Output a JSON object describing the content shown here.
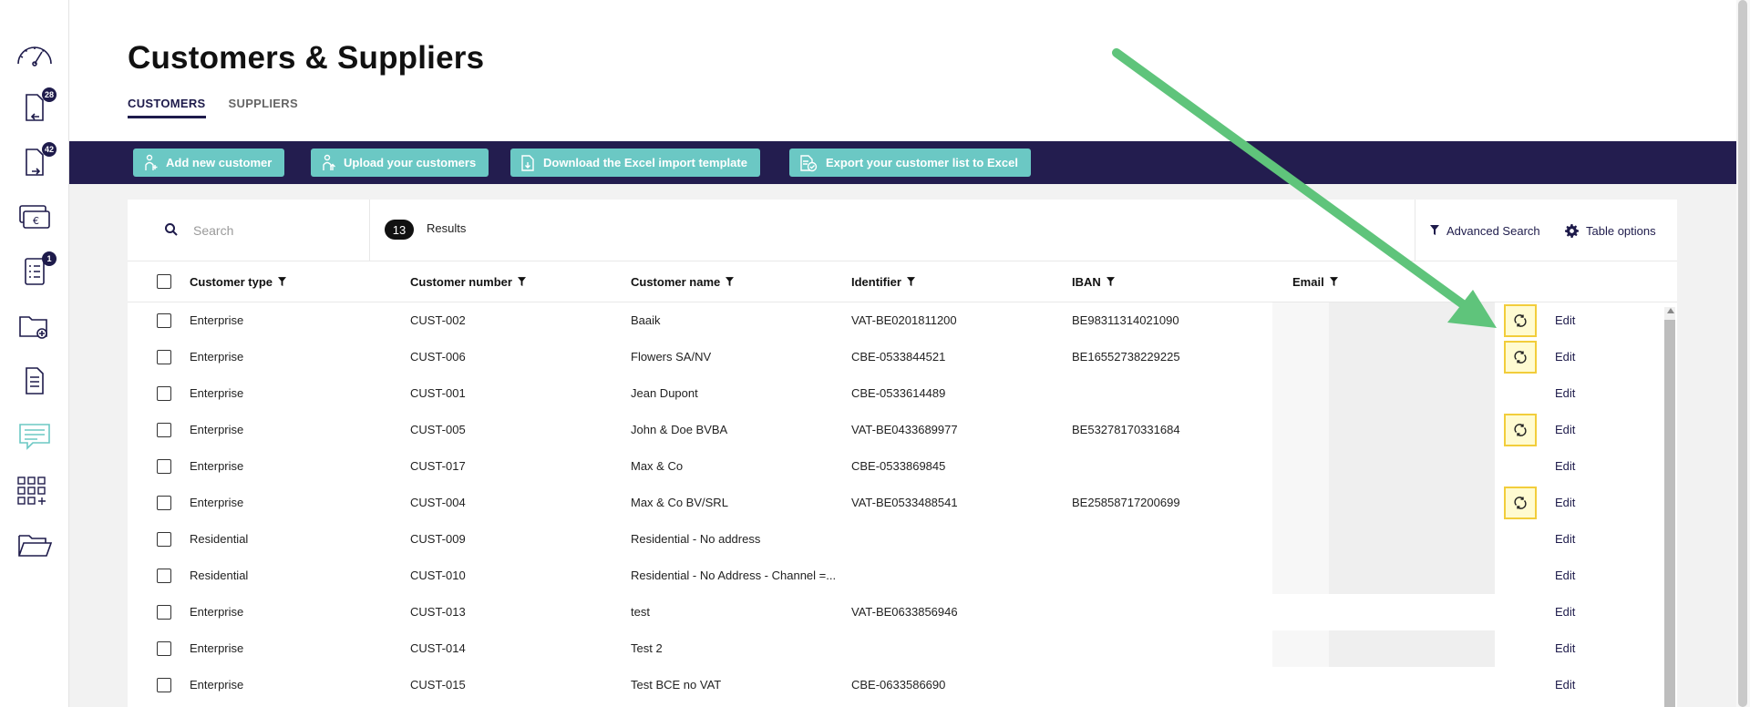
{
  "sidebar": {
    "items": [
      {
        "icon": "dashboard-gauge-icon",
        "badge": ""
      },
      {
        "icon": "incoming-documents-icon",
        "badge": "28"
      },
      {
        "icon": "outgoing-documents-icon",
        "badge": "42"
      },
      {
        "icon": "payments-euro-icon",
        "badge": ""
      },
      {
        "icon": "checklist-icon",
        "badge": "1"
      },
      {
        "icon": "add-folder-icon",
        "badge": ""
      },
      {
        "icon": "document-icon",
        "badge": ""
      },
      {
        "icon": "messages-icon",
        "badge": ""
      },
      {
        "icon": "apps-grid-icon",
        "badge": ""
      },
      {
        "icon": "open-folder-icon",
        "badge": ""
      }
    ]
  },
  "header": {
    "title": "Customers & Suppliers",
    "tabs": [
      {
        "label": "CUSTOMERS",
        "active": true
      },
      {
        "label": "SUPPLIERS",
        "active": false
      }
    ]
  },
  "toolbar": {
    "add_label": "Add new customer",
    "upload_label": "Upload your customers",
    "download_label": "Download the Excel import template",
    "export_label": "Export your customer list to Excel"
  },
  "search": {
    "placeholder": "Search",
    "value": "",
    "results_count": "13",
    "results_label": "Results",
    "advanced_label": "Advanced Search",
    "table_options_label": "Table options"
  },
  "table": {
    "columns": [
      "Customer type",
      "Customer number",
      "Customer name",
      "Identifier",
      "IBAN",
      "Email"
    ],
    "edit_label": "Edit",
    "rows": [
      {
        "type": "Enterprise",
        "number": "CUST-002",
        "name": "Baaik",
        "identifier": "VAT-BE0201811200",
        "iban": "BE98311314021090",
        "email_hidden": true,
        "sync": true
      },
      {
        "type": "Enterprise",
        "number": "CUST-006",
        "name": "Flowers SA/NV",
        "identifier": "CBE-0533844521",
        "iban": "BE16552738229225",
        "email_hidden": true,
        "sync": true
      },
      {
        "type": "Enterprise",
        "number": "CUST-001",
        "name": "Jean Dupont",
        "identifier": "CBE-0533614489",
        "iban": "",
        "email_hidden": true,
        "sync": false
      },
      {
        "type": "Enterprise",
        "number": "CUST-005",
        "name": "John & Doe BVBA",
        "identifier": "VAT-BE0433689977",
        "iban": "BE53278170331684",
        "email_hidden": true,
        "sync": true
      },
      {
        "type": "Enterprise",
        "number": "CUST-017",
        "name": "Max & Co",
        "identifier": "CBE-0533869845",
        "iban": "",
        "email_hidden": true,
        "sync": false
      },
      {
        "type": "Enterprise",
        "number": "CUST-004",
        "name": "Max & Co BV/SRL",
        "identifier": "VAT-BE0533488541",
        "iban": "BE25858717200699",
        "email_hidden": true,
        "sync": true
      },
      {
        "type": "Residential",
        "number": "CUST-009",
        "name": "Residential - No address",
        "identifier": "",
        "iban": "",
        "email_hidden": true,
        "sync": false
      },
      {
        "type": "Residential",
        "number": "CUST-010",
        "name": "Residential - No Address - Channel =...",
        "identifier": "",
        "iban": "",
        "email_hidden": true,
        "sync": false
      },
      {
        "type": "Enterprise",
        "number": "CUST-013",
        "name": "test",
        "identifier": "VAT-BE0633856946",
        "iban": "",
        "email_hidden": false,
        "sync": false
      },
      {
        "type": "Enterprise",
        "number": "CUST-014",
        "name": "Test 2",
        "identifier": "",
        "iban": "",
        "email_hidden": true,
        "sync": false
      },
      {
        "type": "Enterprise",
        "number": "CUST-015",
        "name": "Test BCE no VAT",
        "identifier": "CBE-0633586690",
        "iban": "",
        "email_hidden": false,
        "sync": false
      }
    ]
  },
  "colors": {
    "navy": "#231d4f",
    "teal": "#6bc8c4",
    "highlight_bg": "#fffbd1",
    "highlight_border": "#f2cd3b",
    "annotation_arrow": "#5fc47b"
  }
}
